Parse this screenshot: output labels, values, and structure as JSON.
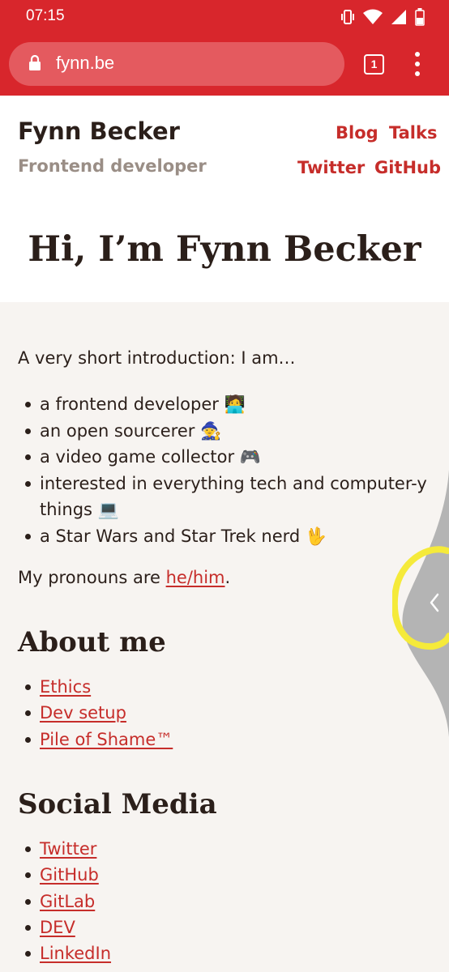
{
  "status_bar": {
    "time": "07:15"
  },
  "browser": {
    "url": "fynn.be",
    "tab_count": "1"
  },
  "header": {
    "site_name": "Fynn Becker",
    "tagline": "Frontend developer",
    "nav": {
      "blog": "Blog",
      "talks": "Talks",
      "twitter": "Twitter",
      "github": "GitHub"
    },
    "hero_title": "Hi, I’m Fynn Becker"
  },
  "intro": {
    "text": "A very short introduction: I am…",
    "items": [
      "a frontend developer 🧑‍💻",
      "an open sourcerer 🧙",
      "a video game collector 🎮",
      "interested in everything tech and computer-y things 💻",
      "a Star Wars and Star Trek nerd 🖖"
    ],
    "pronouns_prefix": "My pronouns are ",
    "pronouns_link": "he/him",
    "pronouns_suffix": "."
  },
  "about": {
    "title": "About me",
    "links": [
      "Ethics",
      "Dev setup",
      "Pile of Shame™"
    ]
  },
  "social": {
    "title": "Social Media",
    "links": [
      "Twitter",
      "GitHub",
      "GitLab",
      "DEV",
      "LinkedIn"
    ]
  },
  "colors": {
    "browser_red": "#d8262c",
    "link_red": "#c62d2a",
    "highlight_yellow": "#f5ea3a"
  },
  "icons": [
    "lock-icon",
    "vibrate-icon",
    "wifi-icon",
    "signal-icon",
    "battery-icon",
    "menu-icon",
    "chevron-left-icon"
  ]
}
